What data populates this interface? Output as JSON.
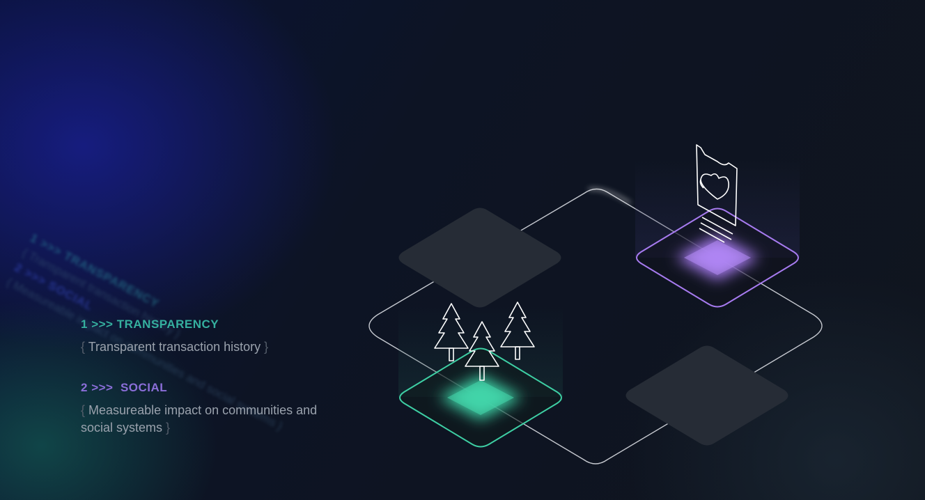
{
  "features": [
    {
      "number": "1",
      "arrow": ">>>",
      "title": "TRANSPARENCY",
      "open_brace": "{",
      "description": "Transparent transaction history",
      "close_brace": "}",
      "color": "#35b09f"
    },
    {
      "number": "2",
      "arrow": ">>>",
      "title": "SOCIAL",
      "open_brace": "{",
      "description": "Measureable impact on communities and social systems",
      "close_brace": "}",
      "color": "#8b6ed9"
    }
  ],
  "colors": {
    "teal_tile": "#3ecfa4",
    "purple_tile": "#a77bf0",
    "gray_tile": "#262c36",
    "outline": "#e6e9ee"
  },
  "illustration": {
    "icons": [
      "pine-tree-icon",
      "heart-card-icon"
    ]
  }
}
